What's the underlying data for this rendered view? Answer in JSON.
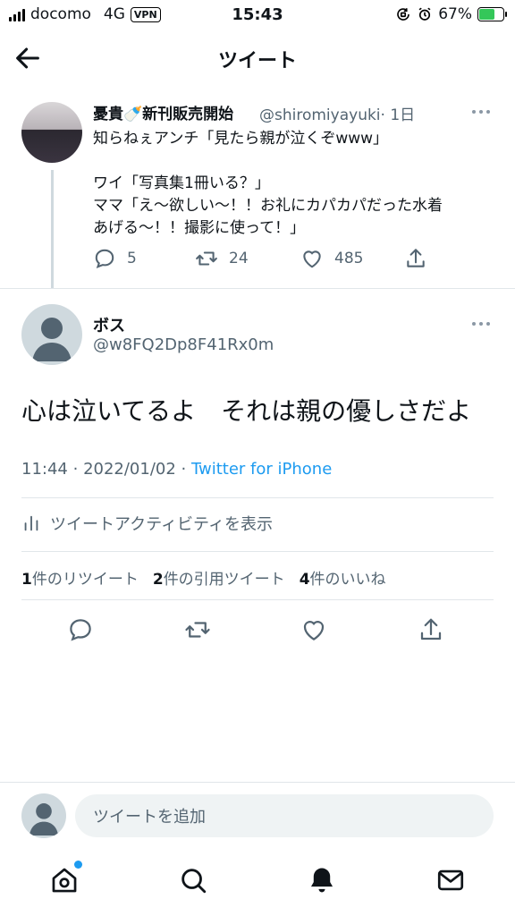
{
  "status_bar": {
    "carrier": "docomo",
    "network": "4G",
    "vpn": "VPN",
    "time": "15:43",
    "battery": "67%",
    "battery_level": 0.67
  },
  "header": {
    "title": "ツイート"
  },
  "parent_tweet": {
    "name": "憂貴🍼新刊販売開始",
    "handle": "@shiromiyayuki",
    "time": "· 1日",
    "text": "知らねぇアンチ「見たら親が泣くぞwww」\n\nワイ「写真集1冊いる？」\nママ「え〜欲しい〜！！お礼にカパカパだった水着\nあげる〜！！撮影に使って！」",
    "replies": "5",
    "retweets": "24",
    "likes": "485"
  },
  "main_tweet": {
    "name": "ボス",
    "handle": "@w8FQ2Dp8F41Rx0m",
    "text": "心は泣いてるよ　それは親の優しさだよ",
    "time": "11:44",
    "date": "2022/01/02",
    "source": "Twitter for iPhone",
    "activity": "ツイートアクティビティを表示",
    "stats": {
      "retweets_count": "1",
      "retweets_label": "件のリツイート",
      "quotes_count": "2",
      "quotes_label": "件の引用ツイート",
      "likes_count": "4",
      "likes_label": "件のいいね"
    }
  },
  "reply": {
    "placeholder": "ツイートを追加"
  },
  "colors": {
    "accent": "#1d9bf0",
    "secondary_text": "#536471",
    "divider": "#e1e6ea"
  }
}
